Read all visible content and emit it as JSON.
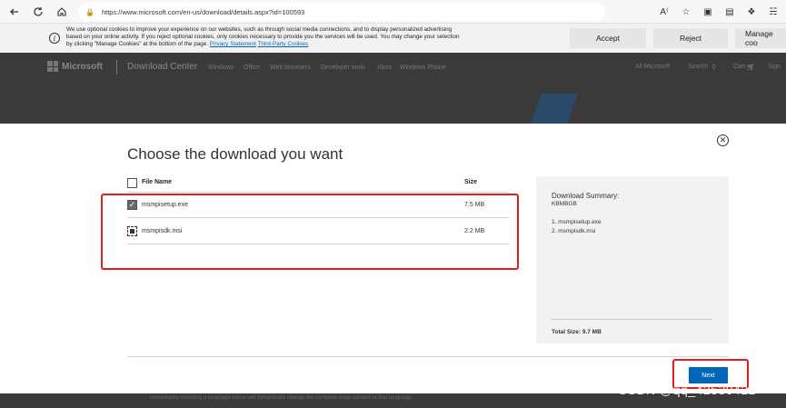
{
  "browser": {
    "url": "https://www.microsoft.com/en-us/download/details.aspx?id=100593"
  },
  "cookie_banner": {
    "text_line1": "We use optional cookies to improve your experience on our websites, such as through social media connections, and to display personalized advertising",
    "text_line2": "based on your online activity. If you reject optional cookies, only cookies necessary to provide you the services will be used. You may change your selection",
    "text_line3": "by clicking \"Manage Cookies\" at the bottom of the page.",
    "privacy_link": "Privacy Statement",
    "third_party_link": "Third-Party Cookies",
    "accept_label": "Accept",
    "reject_label": "Reject",
    "manage_label": "Manage coo"
  },
  "site_header": {
    "logo_text": "Microsoft",
    "section_title": "Download Center",
    "nav": [
      "Windows",
      "Office",
      "Web browsers",
      "Developer tools",
      "Xbox",
      "Windows Phone"
    ],
    "all_microsoft": "All Microsoft",
    "search": "Search",
    "cart": "Cart",
    "sign_in": "Sign"
  },
  "modal": {
    "title": "Choose the download you want",
    "col_name": "File Name",
    "col_size": "Size",
    "files": [
      {
        "name": "msmpisetup.exe",
        "size": "7.5 MB",
        "state": "checked"
      },
      {
        "name": "msmpisdk.msi",
        "size": "2.2 MB",
        "state": "focused"
      }
    ],
    "summary": {
      "title": "Download Summary:",
      "code": "KBMBGB",
      "items": [
        "1. msmpisetup.exe",
        "2. msmpisdk.msi"
      ],
      "total": "Total Size: 9.7 MB"
    },
    "next_label": "Next"
  },
  "bottom_text": "immediately selecting a language below will dynamically change the complete page content to that language.",
  "watermark": "CSDN @qq_42530422",
  "colors": {
    "highlight": "#e31c1c",
    "primary": "#0067b8"
  }
}
